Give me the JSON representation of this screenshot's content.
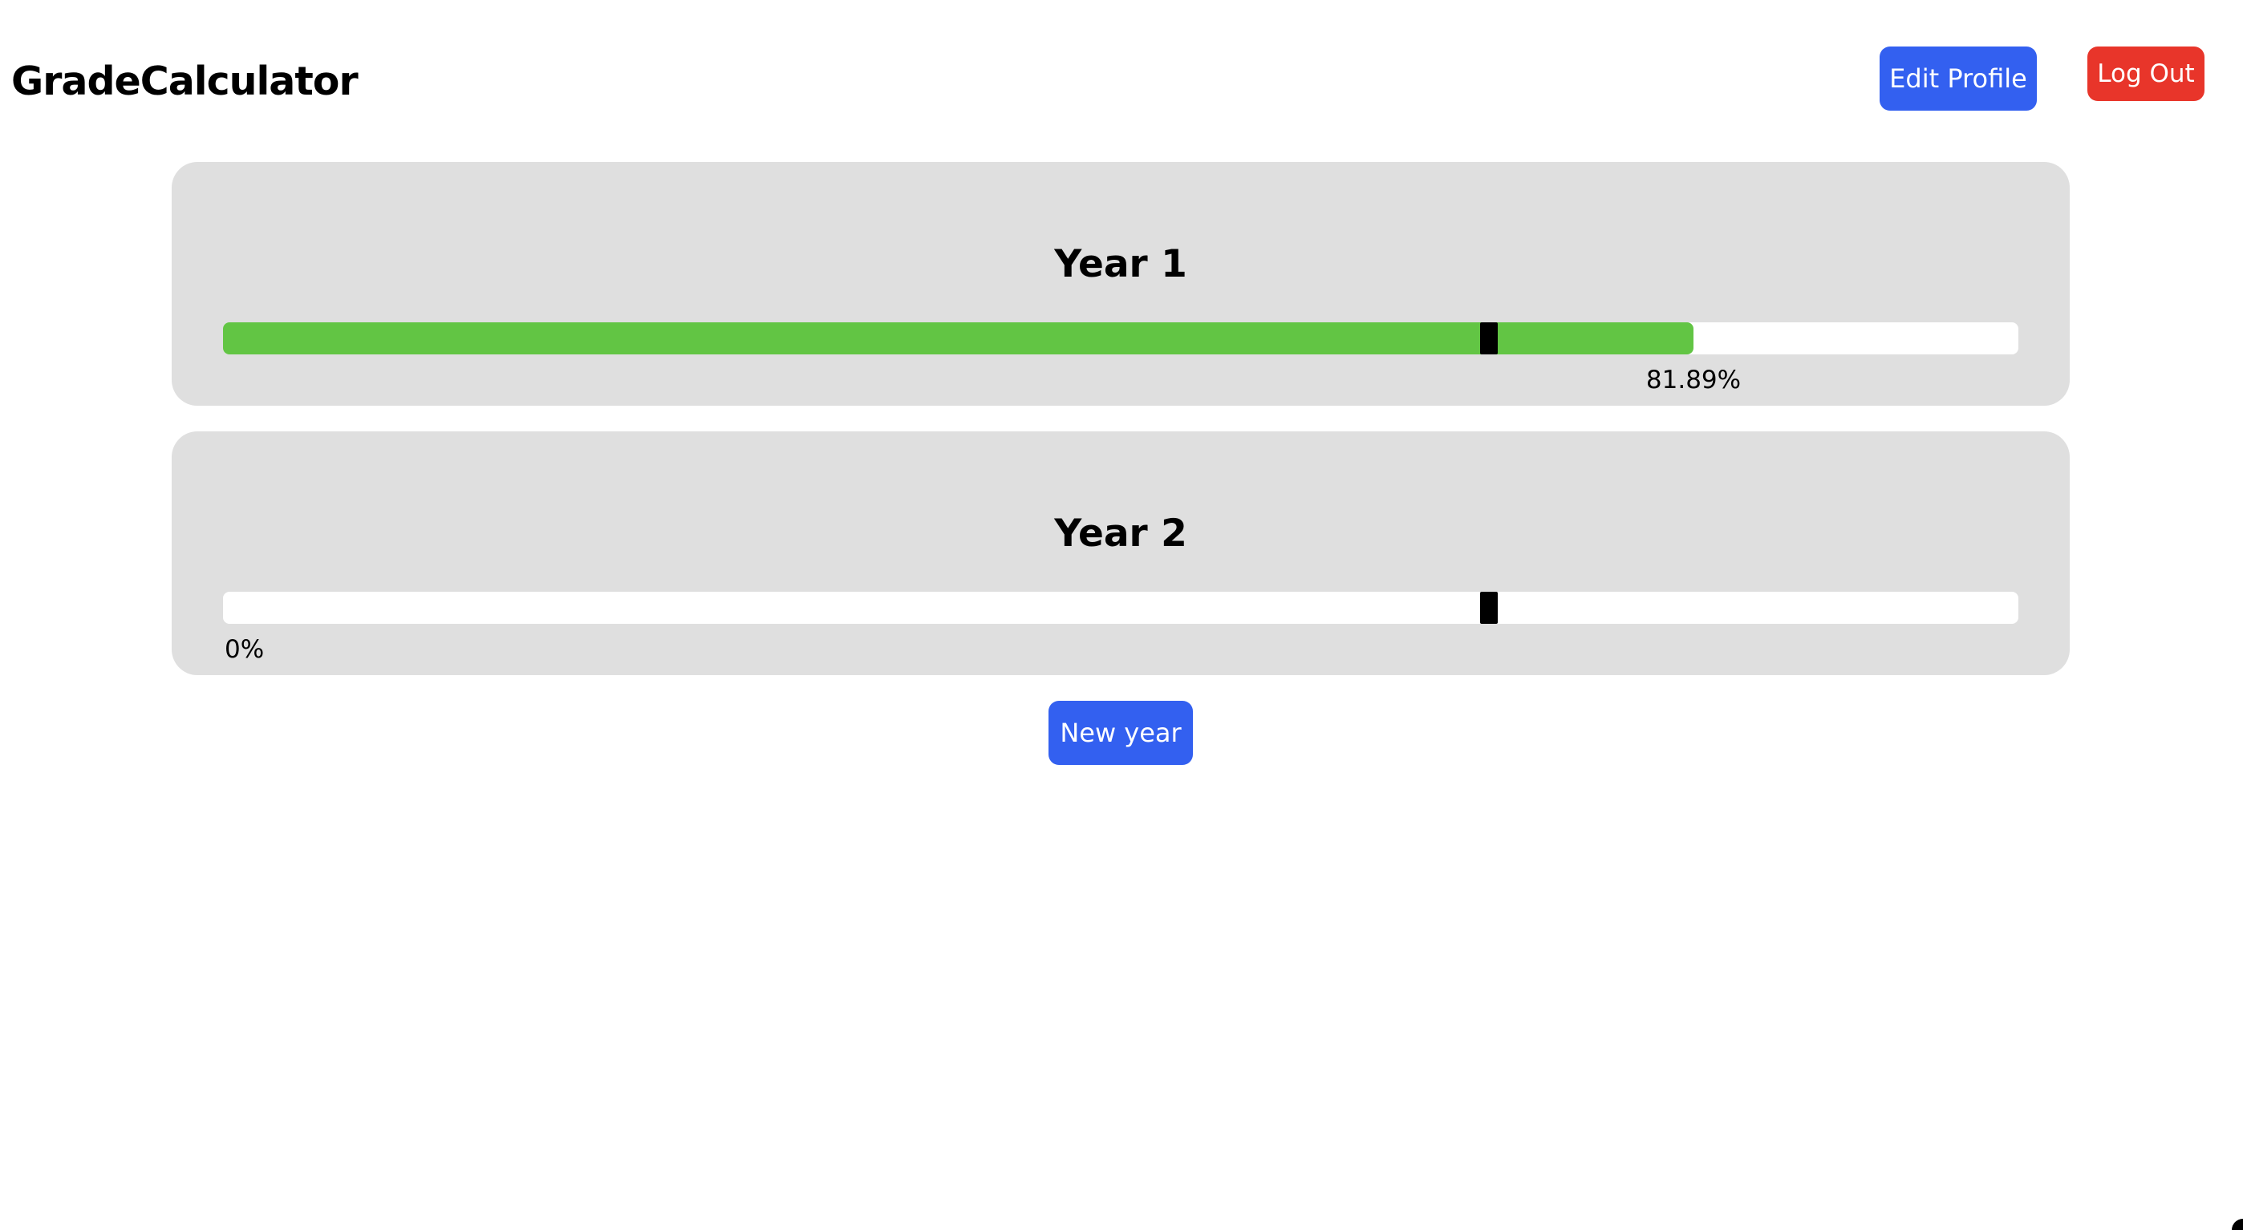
{
  "app": {
    "title": "GradeCalculator"
  },
  "header": {
    "edit_profile_label": "Edit Profile",
    "log_out_label": "Log Out"
  },
  "years": [
    {
      "title": "Year 1",
      "progress_percent": 81.89,
      "progress_label": "81.89%",
      "target_percent": 70.5
    },
    {
      "title": "Year 2",
      "progress_percent": 0,
      "progress_label": "0%",
      "target_percent": 70.5
    }
  ],
  "actions": {
    "new_year_label": "New year"
  },
  "colors": {
    "primary_button": "#3360f0",
    "danger_button": "#e8352a",
    "progress_fill": "#62c544",
    "card_background": "#dfdfdf",
    "target_marker": "#000000"
  }
}
